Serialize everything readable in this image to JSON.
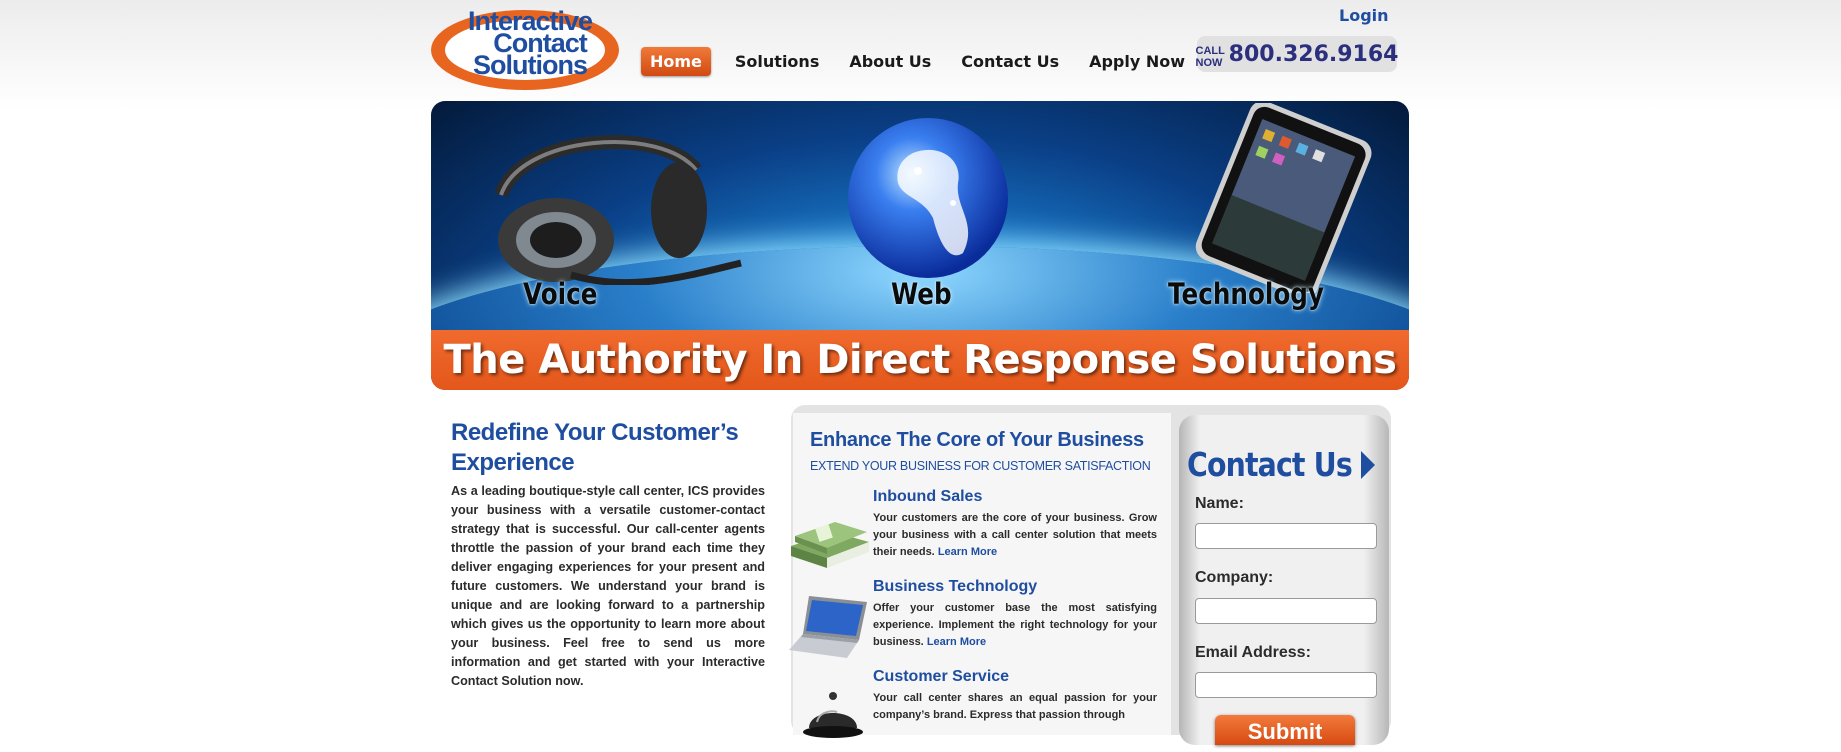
{
  "logo": {
    "lines": [
      "Interactive",
      "Contact",
      "Solutions"
    ]
  },
  "nav": {
    "items": [
      {
        "label": "Home",
        "active": true
      },
      {
        "label": "Solutions",
        "active": false
      },
      {
        "label": "About Us",
        "active": false
      },
      {
        "label": "Contact Us",
        "active": false
      },
      {
        "label": "Apply Now",
        "active": false
      }
    ],
    "login": "Login"
  },
  "callnow": {
    "label": "CALL NOW",
    "number": "800.326.9164"
  },
  "banner": {
    "labels": [
      "Voice",
      "Web",
      "Technology"
    ],
    "tagline": "The Authority In Direct Response Solutions"
  },
  "left": {
    "title": "Redefine Your Customer’s Experience",
    "text": "As a leading boutique-style call center, ICS provides your business with a versatile customer-contact strategy that is successful. Our call-center agents throttle the passion of your brand each time they deliver engaging experiences for your present and future customers. We understand your brand is unique and are looking forward to a partnership which gives us the opportunity to learn more about your business. Feel free to send us more information and get started with your Interactive Contact Solution now."
  },
  "middle": {
    "title": "Enhance The Core of Your Business",
    "subtitle": "EXTEND YOUR BUSINESS FOR CUSTOMER SATISFACTION",
    "features": [
      {
        "title": "Inbound Sales",
        "text": "Your customers are the core of your business. Grow your business with a call center solution that meets their needs.",
        "link": "Learn More",
        "icon": "money-stack-icon"
      },
      {
        "title": "Business Technology",
        "text": "Offer your customer base the most satisfying experience. Implement the right technology for your business.",
        "link": "Learn More",
        "icon": "laptop-icon"
      },
      {
        "title": "Customer Service",
        "text": "Your call center shares an equal passion for your company’s brand. Express that passion through",
        "link": "",
        "icon": "service-bell-icon"
      }
    ]
  },
  "form": {
    "title": "Contact Us",
    "fields": [
      {
        "label": "Name:",
        "value": ""
      },
      {
        "label": "Company:",
        "value": ""
      },
      {
        "label": "Email Address:",
        "value": ""
      }
    ],
    "submit": "Submit"
  },
  "colors": {
    "brand_blue": "#1f4ea0",
    "brand_orange": "#e8651f",
    "text": "#2b2b2b"
  }
}
